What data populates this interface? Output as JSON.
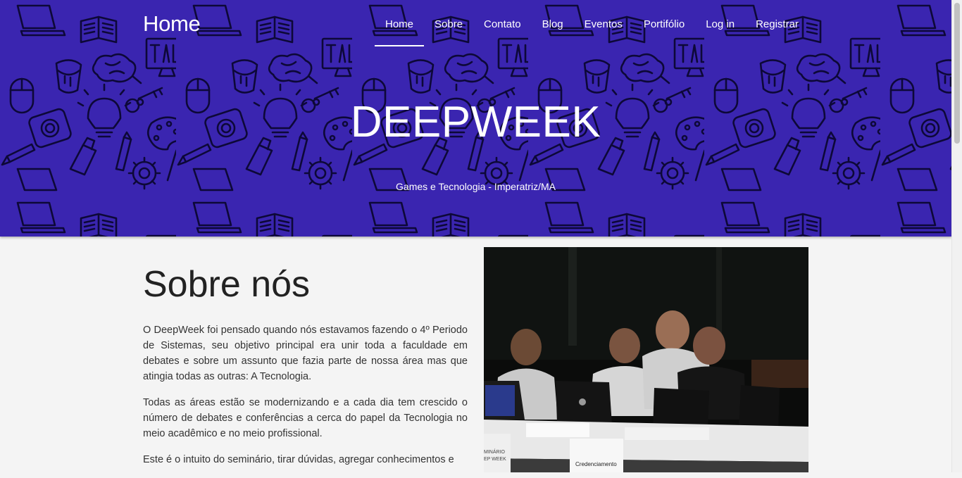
{
  "navbar": {
    "brand": "Home",
    "links": [
      "Home",
      "Sobre",
      "Contato",
      "Blog",
      "Eventos",
      "Portifólio",
      "Log in",
      "Registrar"
    ],
    "active_link": "Home"
  },
  "hero": {
    "title": "DEEPWEEK",
    "subtitle": "Games e Tecnologia - Imperatriz/MA",
    "background_color": "#3a25b0",
    "pattern_icons": [
      "open-book-icon",
      "monitor-icon",
      "paint-bucket-icon",
      "brain-icon",
      "key-icon",
      "mouse-icon",
      "lightbulb-icon",
      "camera-icon",
      "palette-icon",
      "paintbrush-icon",
      "paint-tube-icon",
      "gear-icon",
      "laptop-icon",
      "pencil-icon"
    ]
  },
  "about": {
    "heading": "Sobre nós",
    "paragraphs": [
      "O DeepWeek foi pensado quando nós estavamos fazendo o 4º Periodo de Sistemas, seu objetivo principal era unir toda a faculdade em debates e sobre um assunto que fazia parte de nossa área mas que atingia todas as outras: A Tecnologia.",
      "Todas as áreas estão se modernizando e a cada dia tem crescido o número de debates e conferências a cerca do papel da Tecnologia no meio acadêmico e no meio profissional.",
      "Este é o intuito do seminário, tirar dúvidas, agregar conhecimentos e"
    ]
  },
  "photo": {
    "description_icon": "event-photo",
    "visible_text": [
      "Credenciamento",
      "MINÁRIO",
      "EP WEEK"
    ]
  }
}
